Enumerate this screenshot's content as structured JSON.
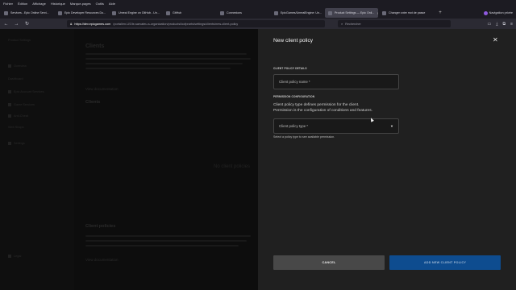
{
  "menubar": {
    "items": [
      "Fichier",
      "Édition",
      "Affichage",
      "Historique",
      "Marque-pages",
      "Outils",
      "Aide"
    ]
  },
  "tabs": [
    {
      "label": "Services - Epic Online Servi...",
      "active": false
    },
    {
      "label": "Epic Developer Resources Do...",
      "active": false
    },
    {
      "label": "Unreal Engine on GitHub - Un...",
      "active": false
    },
    {
      "label": "GitHub",
      "active": false
    },
    {
      "label": "Connexions",
      "active": false
    },
    {
      "label": "EpicGames/UnrealEngine: Un...",
      "active": false
    },
    {
      "label": "Product Settings — Epic Onli...",
      "active": true
    },
    {
      "label": "Changer votre mot de passe",
      "active": false
    }
  ],
  "browser": {
    "new_tab": "+",
    "private_label": "Navigation privée",
    "url_domain": "https://dev.epicgames.com",
    "url_path": "/portal/en-US/le-sarvateu-s-organization/products/loofprarts/settings/clients/new-client-policy",
    "search_placeholder": "Rechercher"
  },
  "background_page": {
    "title": "Clients",
    "link1": "View documentation",
    "subheading": "Clients",
    "empty": "No client policies",
    "section2": "Client policies",
    "link2": "View documentation",
    "sidebar": [
      "Product Settings",
      "Overview",
      "Dashboard",
      "Epic Account Services",
      "Game Services",
      "Anti-Cheat",
      "Web Shops",
      "Settings",
      "Legal"
    ]
  },
  "drawer": {
    "title": "New client policy",
    "close_glyph": "✕",
    "details_label": "CLIENT POLICY DETAILS",
    "name_placeholder": "Client policy name",
    "required_mark": "*",
    "permission_label": "PERMISSION CONFIGURATION",
    "permission_desc_1": "Client policy type defines permission for the client.",
    "permission_desc_2": "Permission is the configuration of conditions and features.",
    "type_placeholder": "Client policy type",
    "type_caret": "▼",
    "type_hint": "Select a policy type to see available permission.",
    "cancel_label": "CANCEL",
    "add_label": "ADD NEW CLIENT POLICY"
  },
  "colors": {
    "drawer_bg": "#202020",
    "primary_button": "#0e4c8f",
    "secondary_button": "#484848"
  }
}
